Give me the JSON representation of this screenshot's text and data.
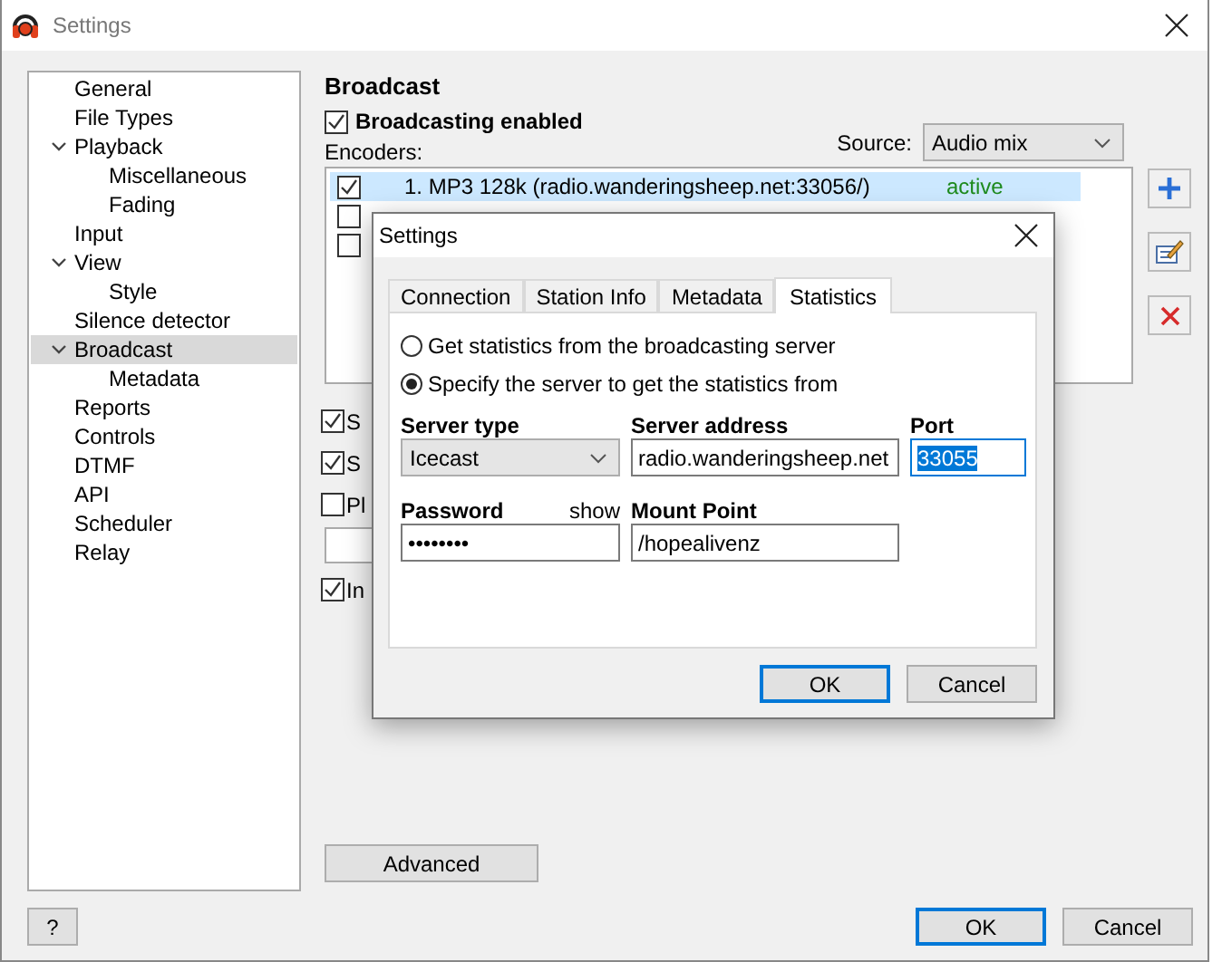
{
  "window": {
    "title": "Settings"
  },
  "sidebar": {
    "items": [
      {
        "label": "General",
        "selected": false
      },
      {
        "label": "File Types",
        "selected": false
      },
      {
        "label": "Playback",
        "selected": false,
        "expanded": true,
        "children": [
          {
            "label": "Miscellaneous",
            "selected": false
          },
          {
            "label": "Fading",
            "selected": false
          }
        ]
      },
      {
        "label": "Input",
        "selected": false
      },
      {
        "label": "View",
        "selected": false,
        "expanded": true,
        "children": [
          {
            "label": "Style",
            "selected": false
          }
        ]
      },
      {
        "label": "Silence detector",
        "selected": false
      },
      {
        "label": "Broadcast",
        "selected": true,
        "expanded": true,
        "children": [
          {
            "label": "Metadata",
            "selected": false
          }
        ]
      },
      {
        "label": "Reports",
        "selected": false
      },
      {
        "label": "Controls",
        "selected": false
      },
      {
        "label": "DTMF",
        "selected": false
      },
      {
        "label": "API",
        "selected": false
      },
      {
        "label": "Scheduler",
        "selected": false
      },
      {
        "label": "Relay",
        "selected": false
      }
    ]
  },
  "page": {
    "heading": "Broadcast",
    "broadcasting_enabled": {
      "label": "Broadcasting enabled",
      "checked": true
    },
    "encoders_label": "Encoders:",
    "source": {
      "label": "Source:",
      "value": "Audio mix"
    },
    "encoders": [
      {
        "label": "1. MP3 128k (radio.wanderingsheep.net:33056/)",
        "status": "active",
        "color": "#1e8a1e",
        "checked": true,
        "selected": true
      },
      {
        "checked": false,
        "selected": false
      },
      {
        "checked": false,
        "selected": false
      }
    ],
    "options": [
      {
        "kind": "checkbox",
        "label": "S",
        "checked": true
      },
      {
        "kind": "checkbox",
        "label": "S",
        "checked": true
      },
      {
        "kind": "checkbox",
        "label": "Pl",
        "checked": false
      },
      {
        "kind": "field"
      },
      {
        "kind": "checkbox",
        "label": "In",
        "checked": true
      }
    ],
    "advanced_button": "Advanced"
  },
  "buttons": {
    "help": "?",
    "ok": "OK",
    "cancel": "Cancel"
  },
  "dialog": {
    "title": "Settings",
    "tabs": [
      {
        "label": "Connection",
        "selected": false
      },
      {
        "label": "Station Info",
        "selected": false
      },
      {
        "label": "Metadata",
        "selected": false
      },
      {
        "label": "Statistics",
        "selected": true
      }
    ],
    "radios": [
      {
        "label": "Get statistics from the broadcasting server",
        "selected": false
      },
      {
        "label": "Specify the server to get the statistics from",
        "selected": true
      }
    ],
    "server_type": {
      "label": "Server type",
      "value": "Icecast"
    },
    "server_address": {
      "label": "Server address",
      "value": "radio.wanderingsheep.net"
    },
    "port": {
      "label": "Port",
      "value": "33055",
      "focused": true
    },
    "password": {
      "label": "Password",
      "show": "show",
      "value": "••••••••"
    },
    "mount_point": {
      "label": "Mount Point",
      "value": "/hopealivenz"
    },
    "ok": "OK",
    "cancel": "Cancel"
  }
}
